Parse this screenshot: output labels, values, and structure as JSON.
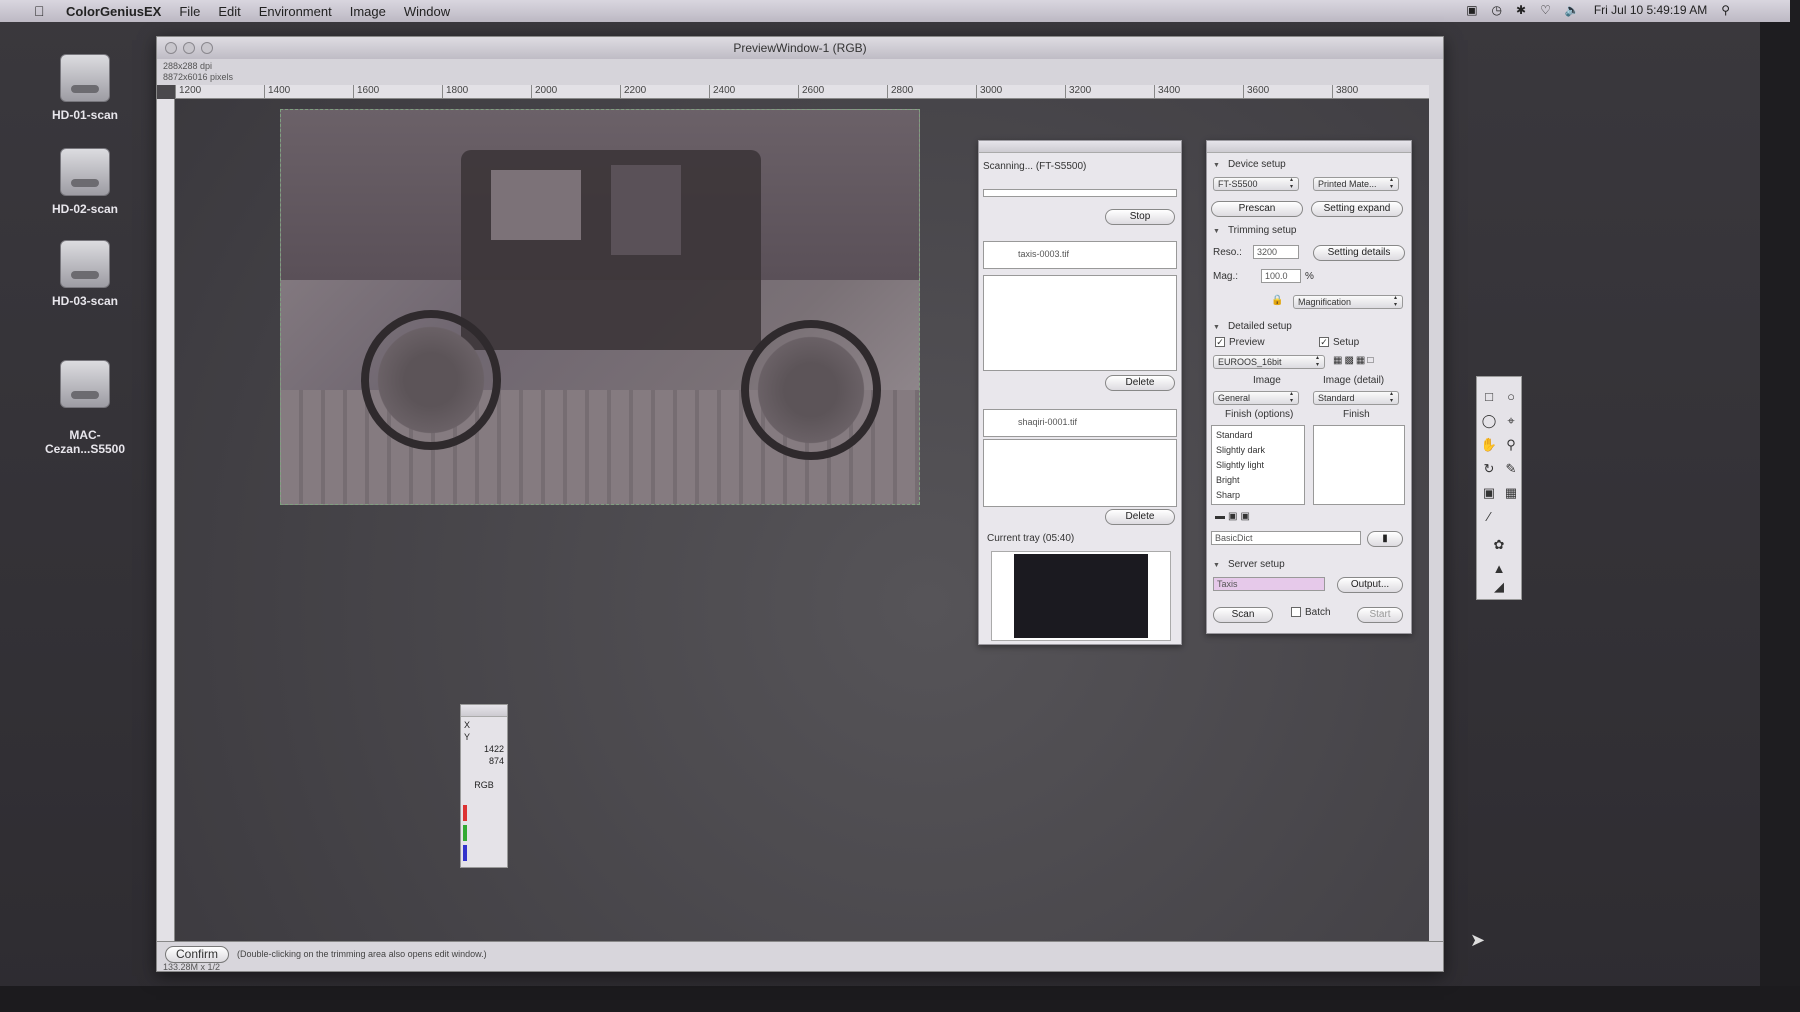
{
  "menubar": {
    "app_name": "ColorGeniusEX",
    "items": [
      "File",
      "Edit",
      "Environment",
      "Image",
      "Window"
    ],
    "clock": "Fri Jul 10  5:49:19 AM"
  },
  "desktop": {
    "icons": [
      {
        "label": "HD-01-scan"
      },
      {
        "label": "HD-02-scan"
      },
      {
        "label": "HD-03-scan"
      },
      {
        "label": "MAC-\nCezan...S5500"
      }
    ]
  },
  "preview_window": {
    "title": "PreviewWindow-1 (RGB)",
    "dpi": "288x288 dpi",
    "pixels": "8872x6016 pixels",
    "ruler_ticks": [
      "1200",
      "1400",
      "1600",
      "1800",
      "2000",
      "2200",
      "2400",
      "2600",
      "2800",
      "3000",
      "3200",
      "3400",
      "3600",
      "3800"
    ],
    "confirm_label": "Confirm",
    "hint": "(Double-clicking on the trimming area also opens edit window.)",
    "zoom": "133.28M x 1/2"
  },
  "scan_panel": {
    "status": "Scanning... (FT-S5500)",
    "stop_label": "Stop",
    "item1": "taxis-0003.tif",
    "delete1": "Delete",
    "item2": "shaqiri-0001.tif",
    "delete2": "Delete",
    "current_tray": "Current tray (05:40)"
  },
  "settings_panel": {
    "device_setup": "Device setup",
    "device": "FT-S5500",
    "printed": "Printed Mate...",
    "prescan": "Prescan",
    "setting_expand": "Setting expand",
    "trimming_setup": "Trimming setup",
    "reso_label": "Reso.:",
    "reso_value": "3200",
    "setting_details": "Setting details",
    "mag_label": "Mag.:",
    "mag_value": "100.0",
    "percent": "%",
    "magnification": "Magnification",
    "detailed_setup": "Detailed setup",
    "preview": "Preview",
    "setup": "Setup",
    "profile": "EUROOS_16bit",
    "image_label": "Image",
    "image_detail_label": "Image (detail)",
    "image_sel": "General",
    "image_detail_sel": "Standard",
    "finish_options_label": "Finish (options)",
    "finish_label": "Finish",
    "finish_options": [
      "Standard",
      "Slightly dark",
      "Slightly light",
      "Bright",
      "Sharp"
    ],
    "dict": "BasicDict",
    "server_setup": "Server setup",
    "server_field": "Taxis",
    "output": "Output...",
    "scan": "Scan",
    "batch": "Batch",
    "start": "Start"
  },
  "info_panel": {
    "x": "X",
    "y": "Y",
    "w_value": "1422",
    "h_value": "874",
    "mode": "RGB"
  }
}
